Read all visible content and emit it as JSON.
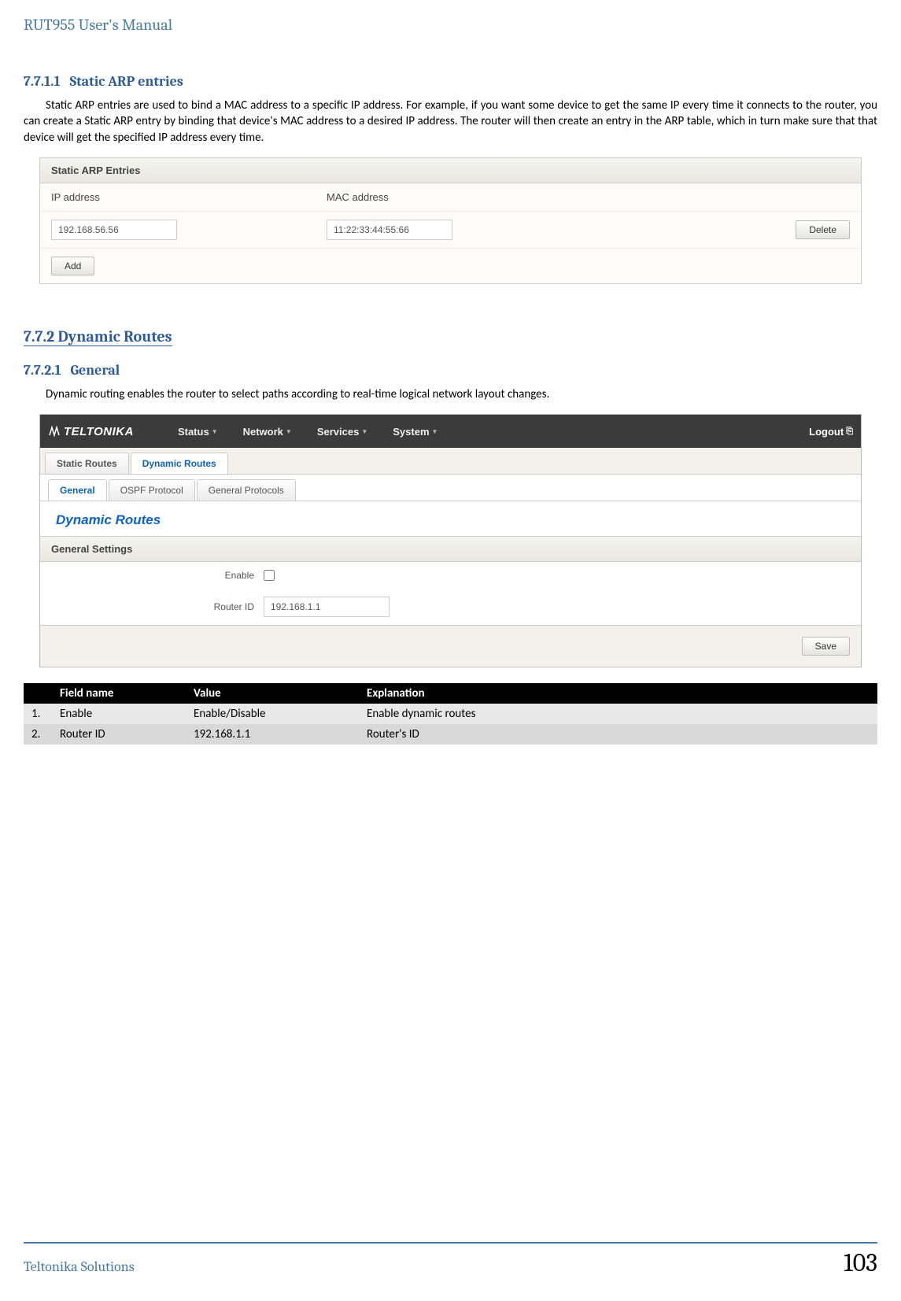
{
  "manual_title": "RUT955 User's Manual",
  "section_arp": {
    "number": "7.7.1.1",
    "title": "Static ARP entries",
    "paragraph": "Static ARP entries are used to bind a MAC address to a specific IP address. For example, if you want some device to get the same IP every time it connects to the router, you can create a Static ARP entry by binding that device's MAC address to a desired IP address. The router will then create an entry in the ARP table, which in turn make sure that that device will get the specified IP address every time."
  },
  "arp_screenshot": {
    "panel_title": "Static ARP Entries",
    "headers": {
      "ip": "IP address",
      "mac": "MAC address"
    },
    "row": {
      "ip": "192.168.56.56",
      "mac": "11:22:33:44:55:66"
    },
    "buttons": {
      "delete": "Delete",
      "add": "Add"
    }
  },
  "section_dynamic": {
    "number": "7.7.2",
    "title": "Dynamic Routes"
  },
  "section_general": {
    "number": "7.7.2.1",
    "title": "General",
    "paragraph": "Dynamic routing enables the router to select paths according to real-time logical network layout changes."
  },
  "router_ui": {
    "brand": "TELTONIKA",
    "menu": [
      "Status",
      "Network",
      "Services",
      "System"
    ],
    "logout": "Logout",
    "tabs": {
      "static": "Static Routes",
      "dynamic": "Dynamic Routes"
    },
    "subtabs": {
      "general": "General",
      "ospf": "OSPF Protocol",
      "protocols": "General Protocols"
    },
    "page_title": "Dynamic Routes",
    "settings_header": "General Settings",
    "form": {
      "enable_label": "Enable",
      "router_id_label": "Router ID",
      "router_id_value": "192.168.1.1"
    },
    "save_button": "Save"
  },
  "table": {
    "headers": {
      "num": "",
      "field": "Field name",
      "value": "Value",
      "explanation": "Explanation"
    },
    "rows": [
      {
        "num": "1.",
        "field": "Enable",
        "value": "Enable/Disable",
        "explanation": "Enable dynamic routes"
      },
      {
        "num": "2.",
        "field": "Router ID",
        "value": "192.168.1.1",
        "explanation": "Router's ID"
      }
    ]
  },
  "footer": {
    "left": "Teltonika Solutions",
    "page": "103"
  }
}
